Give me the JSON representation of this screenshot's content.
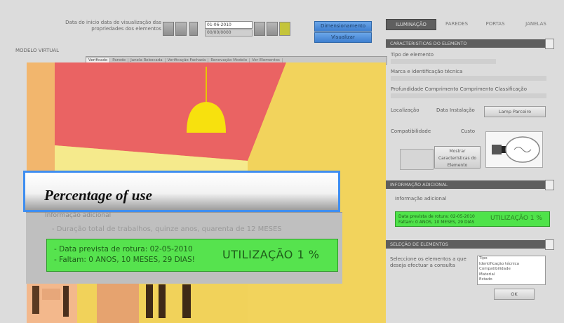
{
  "header": {
    "date_label_line1": "Data do inicio data de visualização das",
    "date_label_line2": "propriedades dos elementos",
    "date_value": "01-06-2010",
    "date_value_2": "00/00/0000",
    "btn_primary": "Dimensionamento",
    "btn_secondary": "Visualizar"
  },
  "viewport": {
    "label": "MODELO VIRTUAL",
    "tabs": [
      "Verificado",
      "Parede",
      "Janela Rebocada",
      "Verificação Fachada",
      "Renovação Modelo",
      "Ver Elementos"
    ]
  },
  "caption": {
    "text": "Percentage of use"
  },
  "overlay": {
    "partial_text": "Informação adicional",
    "info_line": "- Duração total de trabalhos, quinze anos, quarenta de 12 MESES",
    "line1": "- Data prevista de rotura: 02-05-2010",
    "line2": "- Faltam: 0 ANOS, 10 MESES, 29 DIAS!",
    "utilization": "UTILIZAÇÃO 1 %"
  },
  "right_panel": {
    "tabs": [
      "ILUMINAÇÃO",
      "PAREDES",
      "PORTAS",
      "JANELAS"
    ],
    "section_characteristics": "CARACTERISTICAS DO ELEMENTO",
    "labels": {
      "tipo": "Tipo de elemento",
      "marca": "Marca e identificação técnica",
      "fields": "Profundidade  Comprimento  Comprimento  Classificação",
      "localizacao": "Localização",
      "data_instalacao": "Data Instalação",
      "compatibilidade": "Compatibilidade",
      "custo": "Custo"
    },
    "btn_lamp": "Lamp Parceiro",
    "btn_show": "Mostrar Características do Elemento",
    "section_info": "INFORMAÇÃO ADICIONAL",
    "info_label": "Informação adicional",
    "green_line1": "Data prevista de rotura: 02-05-2010",
    "green_line2": "Faltam: 0 ANOS, 10 MESES, 29 DIAS",
    "green_util": "UTILIZAÇÃO 1 %",
    "section_select": "SELEÇÃO DE ELEMENTOS",
    "select_label_line1": "Seleccione os elementos a que",
    "select_label_line2": "deseja efectuar a consulta",
    "list_items": [
      "Tipo",
      "Identificação técnica",
      "Compatibilidade",
      "Material",
      "Estado"
    ],
    "btn_ok": "OK"
  },
  "colors": {
    "accent_blue": "#3f8ef0",
    "status_green": "#56e34e",
    "ceiling_red": "#e96565",
    "wall_yellow": "#f1d25a"
  }
}
